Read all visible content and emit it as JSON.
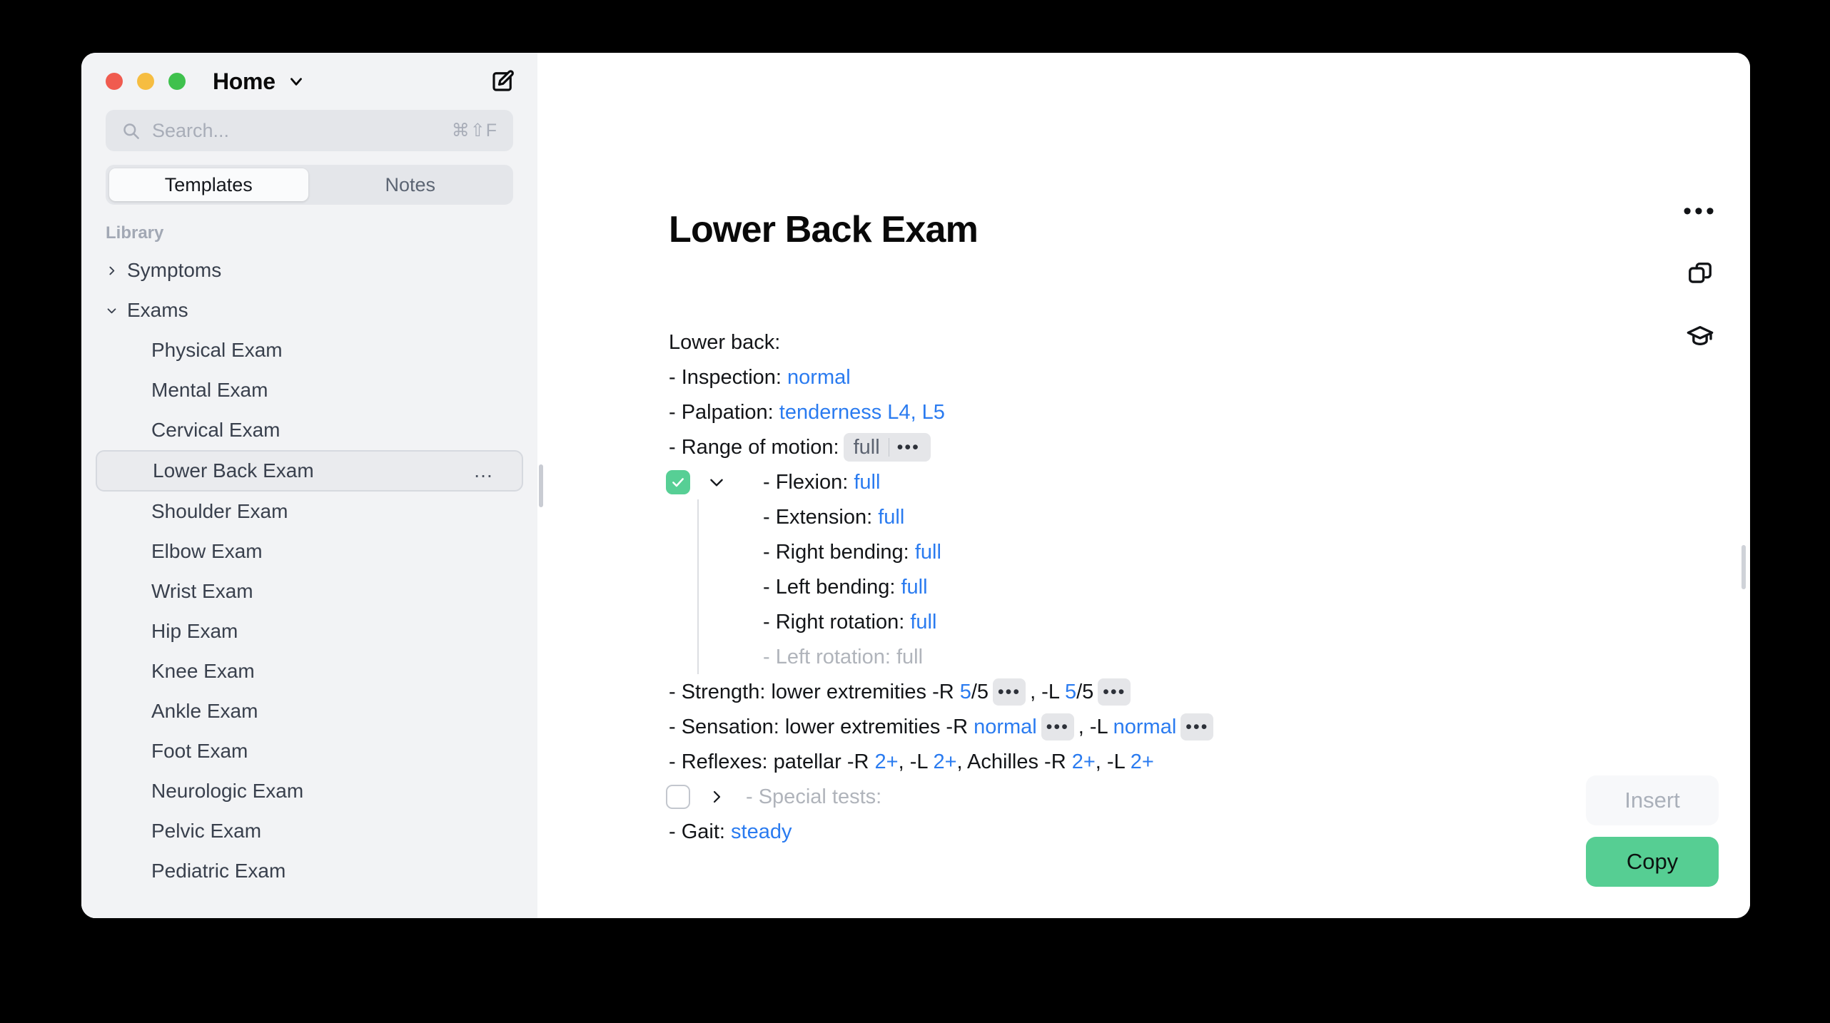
{
  "window": {
    "title": "Home",
    "traffic_lights": [
      "close",
      "minimize",
      "maximize"
    ],
    "compose_icon": "compose-icon",
    "title_chevron_icon": "chevron-down-icon"
  },
  "search": {
    "placeholder": "Search...",
    "value": "",
    "shortcut": "⌘⇧F",
    "icon": "search-icon"
  },
  "tabs": [
    {
      "label": "Templates",
      "active": true
    },
    {
      "label": "Notes",
      "active": false
    }
  ],
  "sidebar": {
    "section_header": "Library",
    "items": [
      {
        "label": "Symptoms",
        "type": "group",
        "expanded": false,
        "twisty": "chevron-right-icon"
      },
      {
        "label": "Exams",
        "type": "group",
        "expanded": true,
        "twisty": "chevron-down-icon"
      },
      {
        "label": "Physical Exam",
        "type": "leaf",
        "selected": false
      },
      {
        "label": "Mental Exam",
        "type": "leaf",
        "selected": false
      },
      {
        "label": "Cervical Exam",
        "type": "leaf",
        "selected": false
      },
      {
        "label": "Lower Back Exam",
        "type": "leaf",
        "selected": true,
        "more": "…"
      },
      {
        "label": "Shoulder Exam",
        "type": "leaf",
        "selected": false
      },
      {
        "label": "Elbow Exam",
        "type": "leaf",
        "selected": false
      },
      {
        "label": "Wrist Exam",
        "type": "leaf",
        "selected": false
      },
      {
        "label": "Hip Exam",
        "type": "leaf",
        "selected": false
      },
      {
        "label": "Knee Exam",
        "type": "leaf",
        "selected": false
      },
      {
        "label": "Ankle Exam",
        "type": "leaf",
        "selected": false
      },
      {
        "label": "Foot Exam",
        "type": "leaf",
        "selected": false
      },
      {
        "label": "Neurologic Exam",
        "type": "leaf",
        "selected": false
      },
      {
        "label": "Pelvic Exam",
        "type": "leaf",
        "selected": false
      },
      {
        "label": "Pediatric Exam",
        "type": "leaf",
        "selected": false
      }
    ]
  },
  "document": {
    "title": "Lower Back Exam",
    "lines": {
      "heading": "Lower back:",
      "inspection_label": "- Inspection: ",
      "inspection_value": "normal",
      "palpation_label": "- Palpation: ",
      "palpation_value": "tenderness L4, L5",
      "rom_label": "- Range of motion:",
      "rom_value": "full",
      "rom_dots": "•••",
      "flexion_label": "- Flexion: ",
      "flexion_value": "full",
      "extension_label": "- Extension: ",
      "extension_value": "full",
      "right_bending_label": "- Right bending: ",
      "right_bending_value": "full",
      "left_bending_label": "- Left bending: ",
      "left_bending_value": "full",
      "right_rotation_label": "- Right rotation: ",
      "right_rotation_value": "full",
      "left_rotation_disabled": "- Left rotation: full",
      "strength_label": "- Strength: lower extremities -R ",
      "strength_r_value": "5",
      "strength_r_rest": "/5",
      "strength_r_dots": "•••",
      "strength_mid": ", -L ",
      "strength_l_value": "5",
      "strength_l_rest": "/5",
      "strength_l_dots": "•••",
      "sensation_label": "- Sensation: lower extremities -R ",
      "sensation_r_value": "normal",
      "sensation_r_dots": "•••",
      "sensation_mid": ", -L ",
      "sensation_l_value": "normal",
      "sensation_l_dots": "•••",
      "reflexes_label": "- Reflexes: patellar -R ",
      "reflexes_v1": "2+",
      "reflexes_s1": ", -L ",
      "reflexes_v2": "2+",
      "reflexes_s2": ", Achilles -R ",
      "reflexes_v3": "2+",
      "reflexes_s3": ", -L ",
      "reflexes_v4": "2+",
      "special_tests": "- Special tests:",
      "gait_label": "- Gait: ",
      "gait_value": "steady"
    }
  },
  "toolbar": {
    "more_dots": "•••",
    "more_name": "more-options-icon",
    "duplicate_name": "copy-icon",
    "learn_name": "graduation-cap-icon"
  },
  "actions": {
    "insert_label": "Insert",
    "copy_label": "Copy"
  },
  "colors": {
    "accent_green": "#56ce93",
    "link_blue": "#2a7bf0",
    "sidebar_bg": "#f2f3f5",
    "muted_text": "#b0b4bb"
  }
}
